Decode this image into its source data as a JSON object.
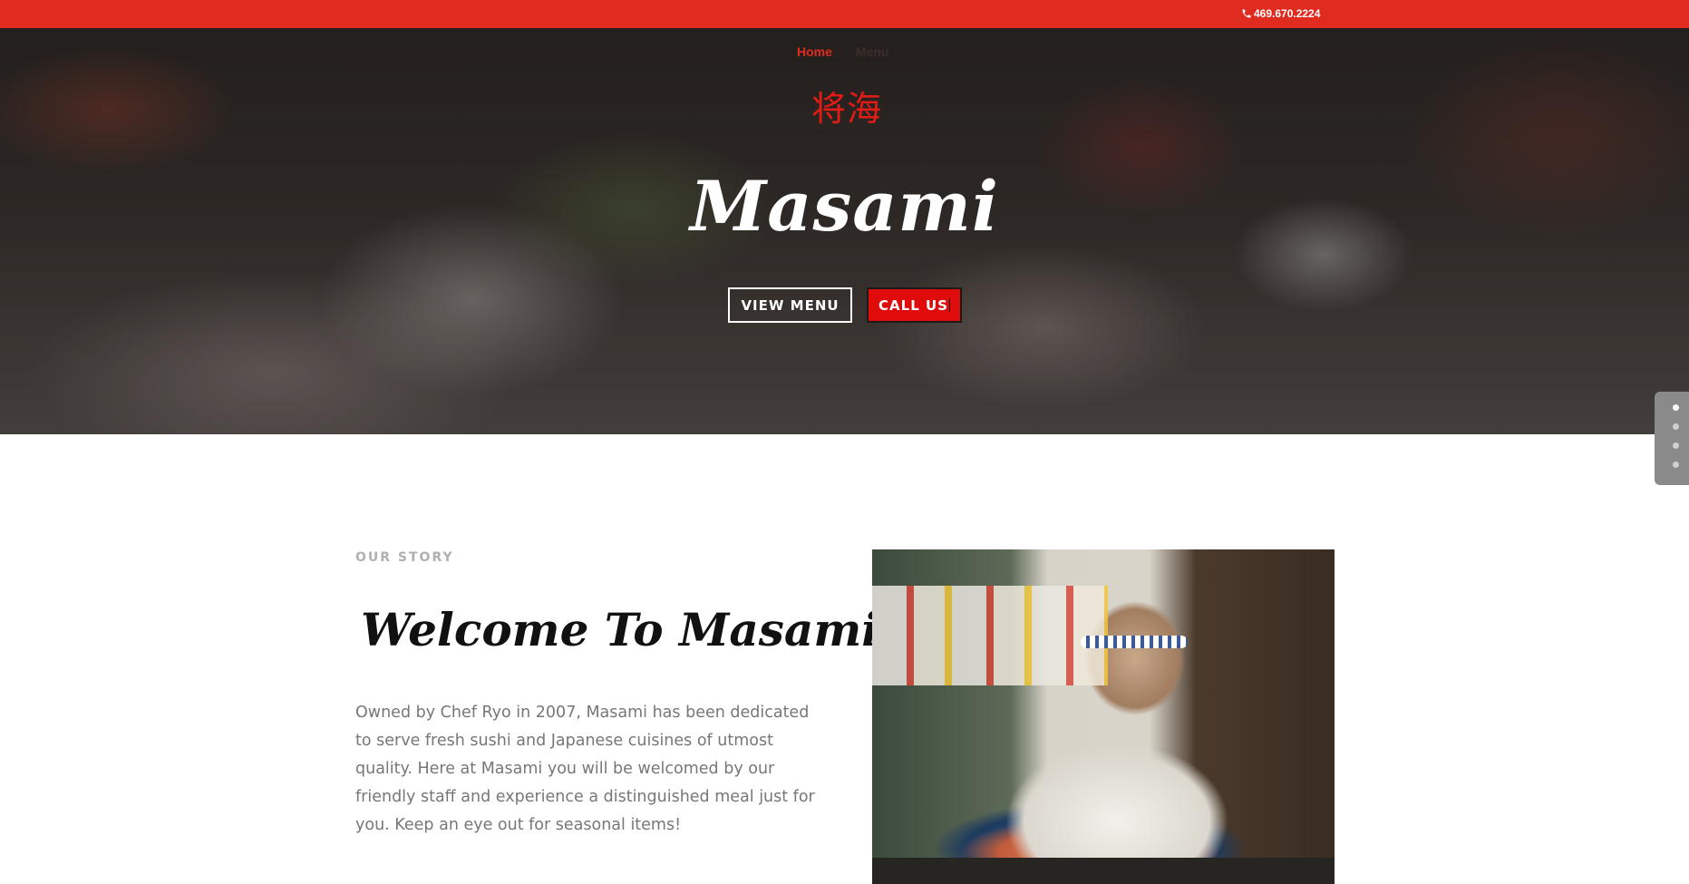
{
  "topbar": {
    "phone": "469.670.2224",
    "phone_icon": "phone-icon",
    "background_color": "#e02b20"
  },
  "nav": {
    "items": [
      {
        "label": "Home",
        "active": true
      },
      {
        "label": "Menu",
        "active": false
      }
    ]
  },
  "hero": {
    "logo_text": "将海",
    "title": "Masami",
    "view_menu_label": "VIEW MENU",
    "call_us_label": "CALL US",
    "accent_color": "#e00c0c"
  },
  "slider_dots": {
    "count": 4,
    "active_index": 0
  },
  "story": {
    "label": "OUR STORY",
    "title": "Welcome To Masami",
    "text": "Owned by Chef Ryo in 2007, Masami has been dedicated to serve fresh sushi and Japanese cuisines of utmost quality.  Here at Masami you will be welcomed by our friendly staff and experience a distinguished meal just for you. Keep an eye out for seasonal items!"
  }
}
